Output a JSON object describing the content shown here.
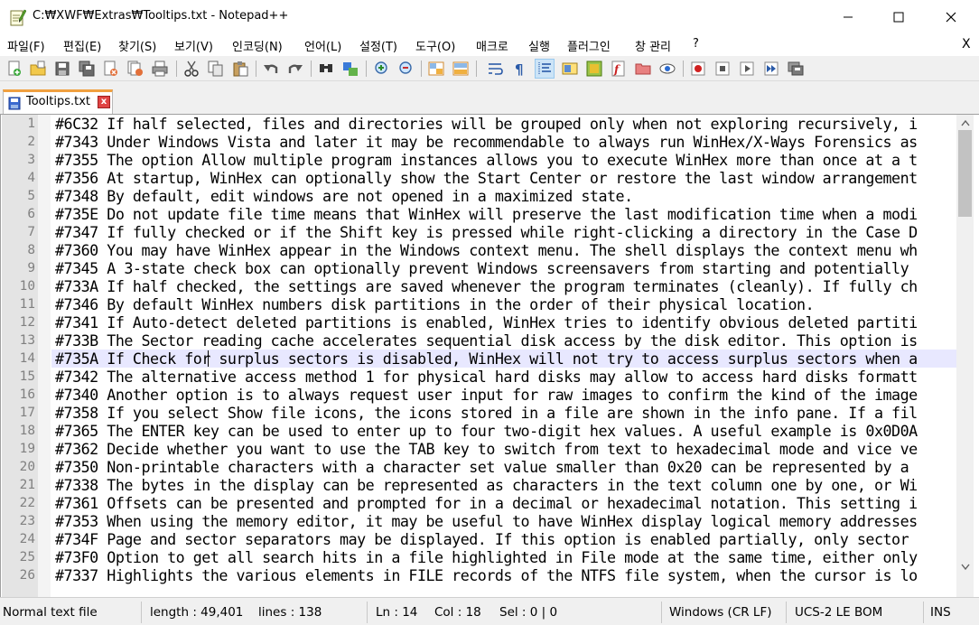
{
  "window": {
    "title": "C:\\\\XWF\\\\Extras\\\\Tooltips.txt - Notepad++",
    "title_display": "C:₩XWF₩Extras₩Tooltips.txt - Notepad++"
  },
  "menu": {
    "items": [
      "파일(F)",
      "편집(E)",
      "찾기(S)",
      "보기(V)",
      "인코딩(N)",
      "언어(L)",
      "설정(T)",
      "도구(O)",
      "매크로",
      "실행",
      "플러그인",
      "창 관리",
      "?"
    ],
    "close_label": "X"
  },
  "toolbar": {
    "icons": [
      "new-file-icon",
      "open-file-icon",
      "save-icon",
      "save-all-icon",
      "close-icon",
      "close-all-icon",
      "print-icon",
      "cut-icon",
      "copy-icon",
      "paste-icon",
      "undo-icon",
      "redo-icon",
      "find-icon",
      "replace-icon",
      "zoom-in-icon",
      "zoom-out-icon",
      "sync-vertical-icon",
      "sync-horizontal-icon",
      "word-wrap-icon",
      "show-all-chars-icon",
      "indent-guide-icon",
      "doc-map-icon",
      "function-list-icon",
      "folder-workspace-icon",
      "doc-list-icon",
      "monitoring-icon",
      "record-macro-icon",
      "stop-macro-icon",
      "play-macro-icon",
      "run-macro-multiple-icon",
      "save-macro-icon"
    ]
  },
  "tabs": [
    {
      "label": "Tooltips.txt",
      "close": "x"
    }
  ],
  "editor": {
    "current_line": 14,
    "lines": [
      {
        "n": "1",
        "text": "#6C32 If half selected, files and directories will be grouped only when not exploring recursively, i"
      },
      {
        "n": "2",
        "text": "#7343 Under Windows Vista and later it may be recommendable to always run WinHex/X-Ways Forensics as"
      },
      {
        "n": "3",
        "text": "#7355 The option Allow multiple program instances allows you to execute WinHex more than once at a t"
      },
      {
        "n": "4",
        "text": "#7356 At startup, WinHex can optionally show the Start Center or restore the last window arrangement"
      },
      {
        "n": "5",
        "text": "#7348 By default, edit windows are not opened in a maximized state."
      },
      {
        "n": "6",
        "text": "#735E Do not update file time means that WinHex will preserve the last modification time when a modi"
      },
      {
        "n": "7",
        "text": "#7347 If fully checked or if the Shift key is pressed while right-clicking a directory in the Case D"
      },
      {
        "n": "8",
        "text": "#7360 You may have WinHex appear in the Windows context menu. The shell displays the context menu wh"
      },
      {
        "n": "9",
        "text": "#7345 A 3-state check box can optionally prevent Windows screensavers from starting and potentially"
      },
      {
        "n": "10",
        "text": "#733A If half checked, the settings are saved whenever the program terminates (cleanly). If fully ch"
      },
      {
        "n": "11",
        "text": "#7346 By default WinHex numbers disk partitions in the order of their physical location."
      },
      {
        "n": "12",
        "text": "#7341 If Auto-detect deleted partitions is enabled, WinHex tries to identify obvious deleted partiti"
      },
      {
        "n": "13",
        "text": "#733B The Sector reading cache accelerates sequential disk access by the disk editor. This option is"
      },
      {
        "n": "14",
        "text": "#735A If Check for surplus sectors is disabled, WinHex will not try to access surplus sectors when a"
      },
      {
        "n": "15",
        "text": "#7342 The alternative access method 1 for physical hard disks may allow to access hard disks formatt"
      },
      {
        "n": "16",
        "text": "#7340 Another option is to always request user input for raw images to confirm the kind of the image"
      },
      {
        "n": "17",
        "text": "#7358 If you select Show file icons, the icons stored in a file are shown in the info pane. If a fil"
      },
      {
        "n": "18",
        "text": "#7365 The ENTER key can be used to enter up to four two-digit hex values. A useful example is 0x0D0A"
      },
      {
        "n": "19",
        "text": "#7362 Decide whether you want to use the TAB key to switch from text to hexadecimal mode and vice ve"
      },
      {
        "n": "20",
        "text": "#7350 Non-printable characters with a character set value smaller than 0x20 can be represented by a"
      },
      {
        "n": "21",
        "text": "#7338 The bytes in the display can be represented as characters in the text column one by one, or Wi"
      },
      {
        "n": "22",
        "text": "#7361 Offsets can be presented and prompted for in a decimal or hexadecimal notation. This setting i"
      },
      {
        "n": "23",
        "text": "#7353 When using the memory editor, it may be useful to have WinHex display logical memory addresses"
      },
      {
        "n": "24",
        "text": "#734F Page and sector separators may be displayed. If this option is enabled partially, only sector"
      },
      {
        "n": "25",
        "text": "#73F0 Option to get all search hits in a file highlighted in File mode at the same time, either only"
      },
      {
        "n": "26",
        "text": "#7337 Highlights the various elements in FILE records of the NTFS file system, when the cursor is lo"
      }
    ]
  },
  "status": {
    "file_type": "Normal text file",
    "length": "length : 49,401",
    "lines": "lines : 138",
    "ln": "Ln : 14",
    "col": "Col : 18",
    "sel": "Sel : 0 | 0",
    "eol": "Windows (CR LF)",
    "encoding": "UCS-2 LE BOM",
    "mode": "INS"
  }
}
